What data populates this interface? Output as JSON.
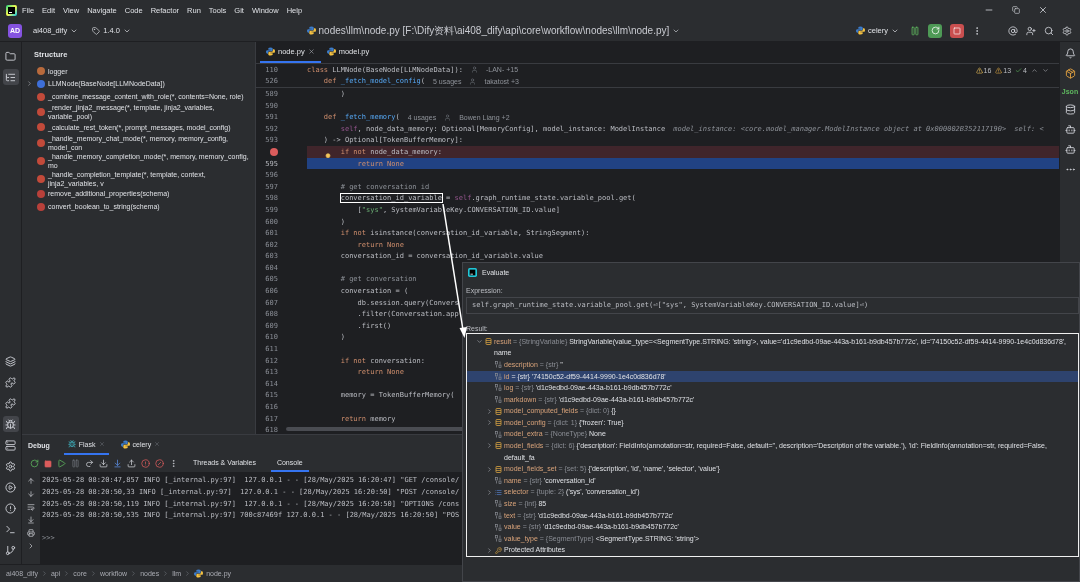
{
  "menu_bar": {
    "items": [
      "File",
      "Edit",
      "View",
      "Navigate",
      "Code",
      "Refactor",
      "Run",
      "Tools",
      "Git",
      "Window",
      "Help"
    ]
  },
  "toolbar": {
    "project_badge": "AD",
    "project": "ai408_dify",
    "version": "1.4.0",
    "file_path": "nodes\\llm\\node.py [F:\\Dify资料\\ai408_dify\\api\\core\\workflow\\nodes\\llm\\node.py]",
    "run_config": "celery"
  },
  "left_tools_top": [
    {
      "kind": "folder",
      "selected": false
    },
    {
      "kind": "structure",
      "selected": true
    }
  ],
  "left_tools_bottom": [
    {
      "kind": "layers",
      "selected": false
    },
    {
      "kind": "plugin",
      "selected": false
    },
    {
      "kind": "plugin",
      "selected": false
    },
    {
      "kind": "debug",
      "selected": true
    },
    {
      "kind": "python",
      "selected": false
    },
    {
      "kind": "services",
      "selected": false
    },
    {
      "kind": "run",
      "selected": false
    },
    {
      "kind": "problems",
      "selected": false
    },
    {
      "kind": "terminal",
      "selected": false
    },
    {
      "kind": "git",
      "selected": false
    }
  ],
  "structure": {
    "title": "Structure",
    "items": [
      {
        "kind": "variable",
        "label": "logger"
      },
      {
        "kind": "class",
        "label": "LLMNode(BaseNode[LLMNodeData])"
      },
      {
        "kind": "method",
        "label": "_combine_message_content_with_role(*, contents=None, role)"
      },
      {
        "kind": "method",
        "label": "_render_jinja2_message(*, template, jinja2_variables, variable_pool)"
      },
      {
        "kind": "method",
        "label": "_calculate_rest_token(*, prompt_messages, model_config)"
      },
      {
        "kind": "method",
        "label": "_handle_memory_chat_mode(*, memory, memory_config, model_con"
      },
      {
        "kind": "method",
        "label": "_handle_memory_completion_mode(*, memory, memory_config, mo"
      },
      {
        "kind": "method",
        "label": "_handle_completion_template(*, template, context, jinja2_variables, v"
      },
      {
        "kind": "function",
        "label": "remove_additional_properties(schema)"
      },
      {
        "kind": "function",
        "label": "convert_boolean_to_string(schema)"
      }
    ]
  },
  "editor": {
    "tabs": [
      {
        "label": "node.py",
        "selected": true
      },
      {
        "label": "model.py",
        "selected": false
      }
    ],
    "inspections": {
      "errors": "16",
      "warnings": "13",
      "ok": "4"
    },
    "lines": [
      {
        "number": "110",
        "kind": "sticky",
        "tokens": [
          {
            "text": "class",
            "kind": "kw"
          },
          {
            "text": " LLMNode(BaseNode[LLMNodeData]):",
            "kind": "plain"
          }
        ],
        "hints": [
          {
            "kind": "author",
            "text": "-LAN- +15"
          }
        ]
      },
      {
        "number": "526",
        "kind": "sticky",
        "tokens": [
          {
            "text": "    def",
            "kind": "kw"
          },
          {
            "text": " _fetch_model_config",
            "kind": "fn"
          },
          {
            "text": "(",
            "kind": "plain"
          }
        ],
        "hints": [
          {
            "kind": "usages",
            "text": "5 usages"
          },
          {
            "kind": "author",
            "text": "takatost +3"
          }
        ]
      },
      {
        "number": "589",
        "kind": "code",
        "tokens": [
          {
            "text": "        )",
            "kind": "plain"
          }
        ]
      },
      {
        "number": "590",
        "kind": "code"
      },
      {
        "number": "591",
        "kind": "code",
        "tokens": [
          {
            "text": "    def",
            "kind": "kw"
          },
          {
            "text": " _fetch_memory",
            "kind": "fn"
          },
          {
            "text": "(",
            "kind": "plain"
          }
        ],
        "hints": [
          {
            "kind": "usages",
            "text": "4 usages"
          },
          {
            "kind": "author",
            "text": "Bowen Liang +2"
          }
        ]
      },
      {
        "number": "592",
        "kind": "code",
        "tokens": [
          {
            "text": "        self",
            "kind": "self"
          },
          {
            "text": ", node_data_memory: Optional[MemoryConfig], model_instance: ModelInstance",
            "kind": "plain"
          }
        ],
        "hints": [
          {
            "kind": "value",
            "text": "model_instance: <core.model_manager.ModelInstance object at 0x000002B352117190>"
          },
          {
            "kind": "value",
            "text": "self: <"
          }
        ]
      },
      {
        "number": "593",
        "kind": "code",
        "tokens": [
          {
            "text": "    ) -> Optional[TokenBufferMemory]:",
            "kind": "plain"
          }
        ]
      },
      {
        "kind": "breakpoint",
        "tokens": [
          {
            "text": "        if not",
            "kind": "kw"
          },
          {
            "text": " node_data_memory:",
            "kind": "plain"
          }
        ]
      },
      {
        "number": "595",
        "kind": "current",
        "tokens": [
          {
            "text": "            return None",
            "kind": "kw"
          }
        ]
      },
      {
        "number": "596",
        "kind": "code"
      },
      {
        "number": "597",
        "kind": "code",
        "tokens": [
          {
            "text": "        # get conversation id",
            "kind": "comment"
          }
        ]
      },
      {
        "number": "598",
        "kind": "code",
        "tokens": [
          {
            "text": "        conversation_id_variable",
            "kind": "framed"
          },
          {
            "text": " = ",
            "kind": "plain"
          },
          {
            "text": "self",
            "kind": "self"
          },
          {
            "text": ".graph_runtime_state.variable_pool.get(",
            "kind": "plain"
          }
        ]
      },
      {
        "number": "599",
        "kind": "code",
        "tokens": [
          {
            "text": "            [",
            "kind": "plain"
          },
          {
            "text": "\"sys\"",
            "kind": "str"
          },
          {
            "text": ", SystemVariableKey.CONVERSATION_ID.value]",
            "kind": "plain"
          }
        ]
      },
      {
        "number": "600",
        "kind": "code",
        "tokens": [
          {
            "text": "        )",
            "kind": "plain"
          }
        ]
      },
      {
        "number": "601",
        "kind": "code",
        "tokens": [
          {
            "text": "        if not",
            "kind": "kw"
          },
          {
            "text": " isinstance(conversation_id_variable, StringSegment):",
            "kind": "plain"
          }
        ]
      },
      {
        "number": "602",
        "kind": "code",
        "tokens": [
          {
            "text": "            return None",
            "kind": "kw"
          }
        ]
      },
      {
        "number": "603",
        "kind": "code",
        "tokens": [
          {
            "text": "        conversation_id = conversation_id_variable.value",
            "kind": "plain"
          }
        ]
      },
      {
        "number": "604",
        "kind": "code"
      },
      {
        "number": "605",
        "kind": "code",
        "tokens": [
          {
            "text": "        # get conversation",
            "kind": "comment"
          }
        ]
      },
      {
        "number": "606",
        "kind": "code",
        "tokens": [
          {
            "text": "        conversation = (",
            "kind": "plain"
          }
        ]
      },
      {
        "number": "607",
        "kind": "code",
        "tokens": [
          {
            "text": "            db.session.query(Convers",
            "kind": "plain"
          }
        ]
      },
      {
        "number": "608",
        "kind": "code",
        "tokens": [
          {
            "text": "            .filter(Conversation.app",
            "kind": "plain"
          }
        ]
      },
      {
        "number": "609",
        "kind": "code",
        "tokens": [
          {
            "text": "            .first()",
            "kind": "plain"
          }
        ]
      },
      {
        "number": "610",
        "kind": "code",
        "tokens": [
          {
            "text": "        )",
            "kind": "plain"
          }
        ]
      },
      {
        "number": "611",
        "kind": "code"
      },
      {
        "number": "612",
        "kind": "code",
        "tokens": [
          {
            "text": "        if not",
            "kind": "kw"
          },
          {
            "text": " conversation:",
            "kind": "plain"
          }
        ]
      },
      {
        "number": "613",
        "kind": "code",
        "tokens": [
          {
            "text": "            return None",
            "kind": "kw"
          }
        ]
      },
      {
        "number": "614",
        "kind": "code"
      },
      {
        "number": "615",
        "kind": "code",
        "tokens": [
          {
            "text": "        memory = TokenBufferMemory(",
            "kind": "plain"
          }
        ]
      },
      {
        "number": "616",
        "kind": "code"
      },
      {
        "number": "617",
        "kind": "code",
        "tokens": [
          {
            "text": "        return",
            "kind": "kw"
          },
          {
            "text": " memory",
            "kind": "plain"
          }
        ]
      },
      {
        "number": "618",
        "kind": "code"
      }
    ]
  },
  "right_tools": [
    {
      "kind": "bell"
    },
    {
      "kind": "package"
    },
    {
      "kind": "text",
      "label": "Json"
    },
    {
      "kind": "database"
    },
    {
      "kind": "bot"
    },
    {
      "kind": "bot"
    },
    {
      "kind": "more"
    }
  ],
  "debug": {
    "title": "Debug",
    "sessions": [
      {
        "label": "Flask",
        "selected": true
      },
      {
        "label": "celery",
        "selected": false
      }
    ],
    "views": [
      {
        "label": "Threads & Variables",
        "selected": false
      },
      {
        "label": "Console",
        "selected": true
      }
    ],
    "console_lines": [
      "2025-05-28 08:20:47,857 INFO [_internal.py:97]  127.0.0.1 - - [28/May/2025 16:20:47] \"GET /console/",
      "2025-05-28 08:20:50,33 INFO [_internal.py:97]  127.0.0.1 - - [28/May/2025 16:20:50] \"POST /console/",
      "2025-05-28 08:20:50,119 INFO [_internal.py:97]  127.0.0.1 - - [28/May/2025 16:20:50] \"OPTIONS /cons",
      "2025-05-28 08:20:50,535 INFO [_internal.py:97] 700c87469f 127.0.0.1 - - [28/May/2025 16:20:50] \"POS"
    ],
    "prompt": ">>>"
  },
  "breadcrumbs": [
    "ai408_dify",
    "api",
    "core",
    "workflow",
    "nodes",
    "llm",
    "node.py"
  ],
  "evaluate": {
    "title": "Evaluate",
    "expression_label": "Expression:",
    "expression": "self.graph_runtime_state.variable_pool.get(⏎[\"sys\", SystemVariableKey.CONVERSATION_ID.value]⏎)",
    "result_label": "Result:",
    "tree": [
      {
        "kind": "object",
        "expanded": true,
        "selected": false,
        "name": "result",
        "type": "= {StringVariable}",
        "value": "StringVariable(value_type=<SegmentType.STRING: 'string'>, value='d1c9edbd-09ae-443a-b161-b9db457b772c', id='74150c52-df59-4414-9990-1e4c0d836d78', name",
        "children": [
          {
            "kind": "field",
            "selected": false,
            "name": "description",
            "type": "= {str}",
            "value": "''"
          },
          {
            "kind": "field",
            "selected": true,
            "name": "id",
            "type": "= {str}",
            "value": "'74150c52-df59-4414-9990-1e4c0d836d78'"
          },
          {
            "kind": "field",
            "selected": false,
            "name": "log",
            "type": "= {str}",
            "value": "'d1c9edbd-09ae-443a-b161-b9db457b772c'"
          },
          {
            "kind": "field",
            "selected": false,
            "name": "markdown",
            "type": "= {str}",
            "value": "'d1c9edbd-09ae-443a-b161-b9db457b772c'"
          },
          {
            "kind": "object",
            "expanded": false,
            "selected": false,
            "name": "model_computed_fields",
            "type": "= {dict: 0}",
            "value": "{}"
          },
          {
            "kind": "object",
            "expanded": false,
            "selected": false,
            "name": "model_config",
            "type": "= {dict: 1}",
            "value": "{'frozen': True}"
          },
          {
            "kind": "field",
            "selected": false,
            "name": "model_extra",
            "type": "= {NoneType}",
            "value": "None"
          },
          {
            "kind": "object",
            "expanded": false,
            "selected": false,
            "name": "model_fields",
            "type": "= {dict: 6}",
            "value": "{'description': FieldInfo(annotation=str, required=False, default='', description='Description of the variable.'), 'id': FieldInfo(annotation=str, required=False, default_fa"
          },
          {
            "kind": "object",
            "expanded": false,
            "selected": false,
            "name": "model_fields_set",
            "type": "= {set: 5}",
            "value": "{'description', 'id', 'name', 'selector', 'value'}"
          },
          {
            "kind": "field",
            "selected": false,
            "name": "name",
            "type": "= {str}",
            "value": "'conversation_id'"
          },
          {
            "kind": "list",
            "expanded": false,
            "selected": false,
            "name": "selector",
            "type": "= {tuple: 2}",
            "value": "('sys', 'conversation_id')"
          },
          {
            "kind": "field",
            "selected": false,
            "name": "size",
            "type": "= {int}",
            "value": "85"
          },
          {
            "kind": "field",
            "selected": false,
            "name": "text",
            "type": "= {str}",
            "value": "'d1c9edbd-09ae-443a-b161-b9db457b772c'"
          },
          {
            "kind": "field",
            "selected": false,
            "name": "value",
            "type": "= {str}",
            "value": "'d1c9edbd-09ae-443a-b161-b9db457b772c'"
          },
          {
            "kind": "field",
            "selected": false,
            "name": "value_type",
            "type": "= {SegmentType}",
            "value": "<SegmentType.STRING: 'string'>"
          },
          {
            "kind": "protected",
            "expanded": false,
            "selected": false,
            "name": "Protected Attributes"
          }
        ]
      }
    ]
  }
}
